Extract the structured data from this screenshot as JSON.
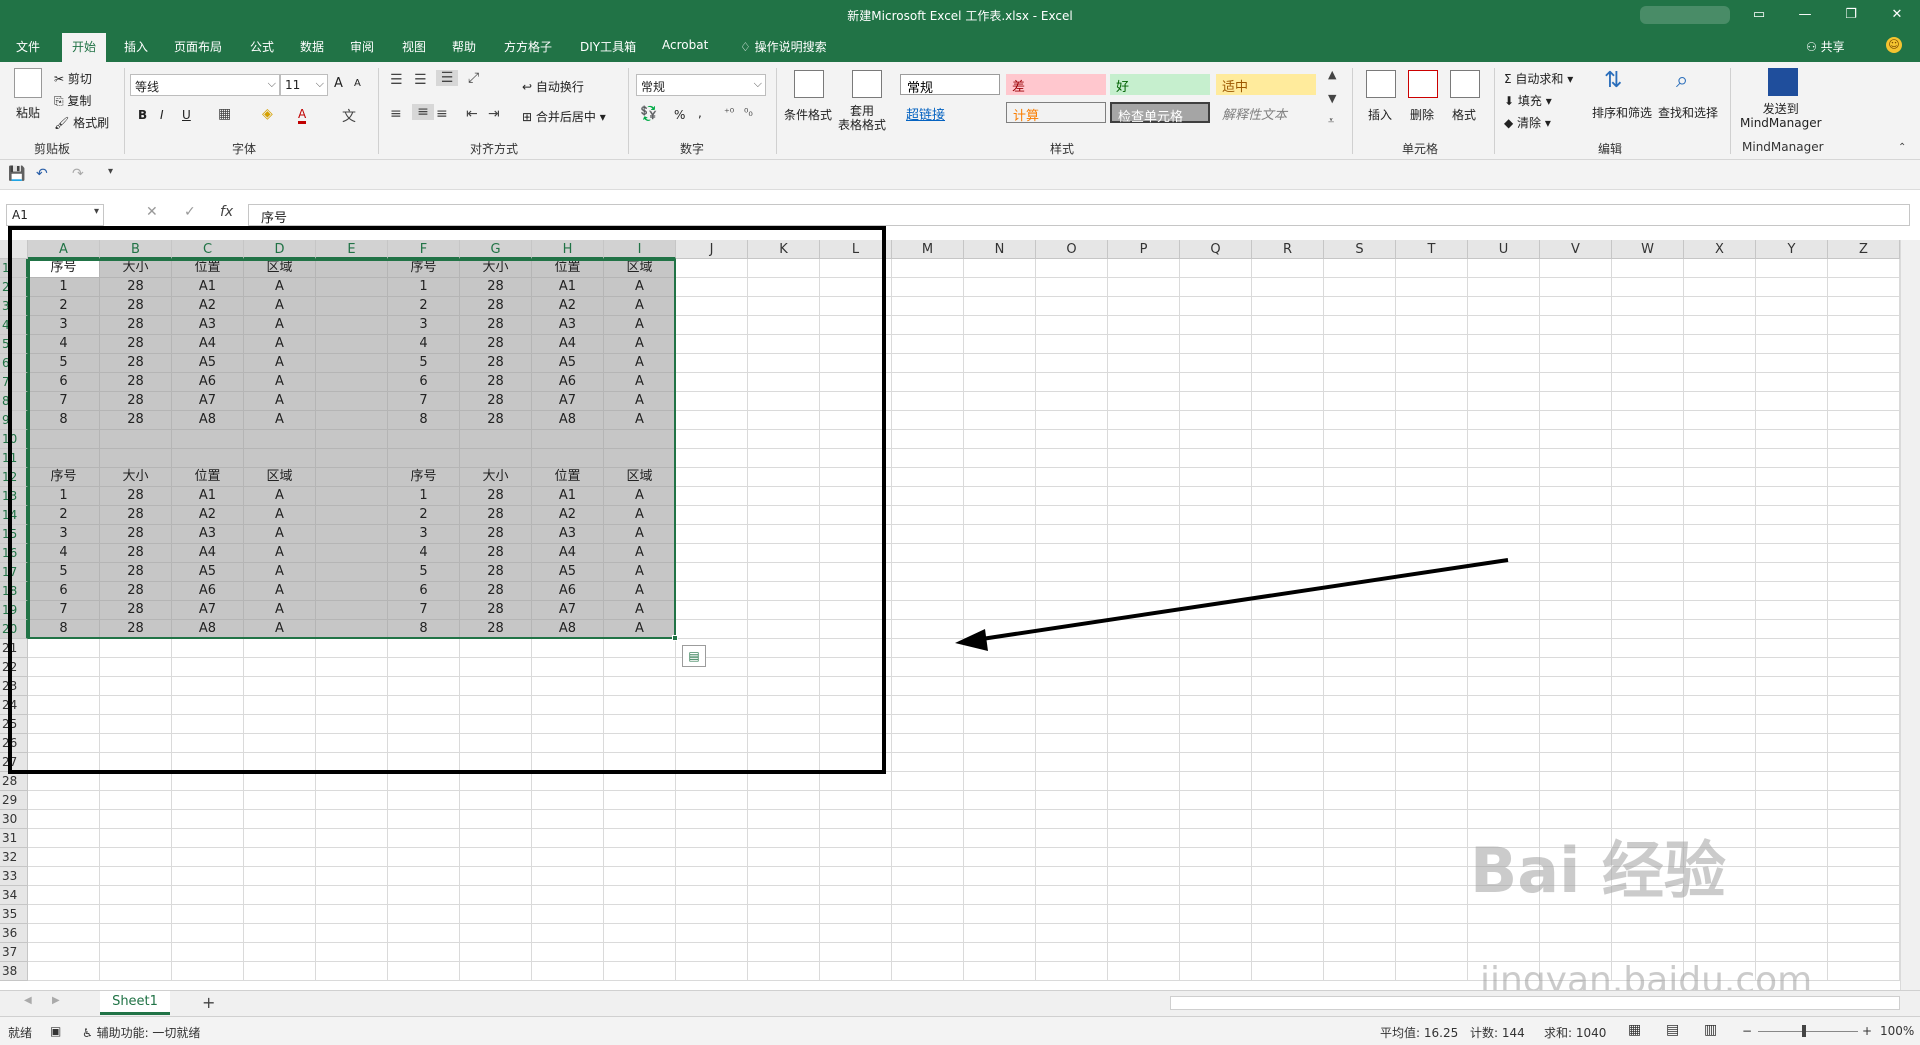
{
  "window": {
    "title": "新建Microsoft Excel 工作表.xlsx  -  Excel",
    "minimize": "—",
    "restore": "❐",
    "close": "✕",
    "ribbon_display": "▭"
  },
  "tabs": [
    "文件",
    "开始",
    "插入",
    "页面布局",
    "公式",
    "数据",
    "审阅",
    "视图",
    "帮助",
    "方方格子",
    "DIY工具箱",
    "Acrobat"
  ],
  "active_tab": "开始",
  "tell_me": "操作说明搜索",
  "share": "共享",
  "ribbon": {
    "clipboard": {
      "paste": "粘贴",
      "cut": "剪切",
      "copy": "复制",
      "format_painter": "格式刷",
      "label": "剪贴板"
    },
    "font": {
      "name": "等线",
      "size": "11",
      "bold": "B",
      "italic": "I",
      "underline": "U",
      "font_color": "A",
      "label": "字体",
      "grow": "A",
      "shrink": "A"
    },
    "alignment": {
      "wrap": "自动换行",
      "merge": "合并后居中",
      "label": "对齐方式"
    },
    "number": {
      "format": "常规",
      "percent": "%",
      "comma": ",",
      "label": "数字"
    },
    "styles": {
      "conditional": "条件格式",
      "table": "套用\n表格格式",
      "cells": [
        {
          "text": "常规",
          "bg": "#ffffff",
          "fg": "#000000"
        },
        {
          "text": "差",
          "bg": "#ffc7ce",
          "fg": "#9c0006"
        },
        {
          "text": "好",
          "bg": "#c6efce",
          "fg": "#006100"
        },
        {
          "text": "适中",
          "bg": "#ffeb9c",
          "fg": "#9c5700"
        },
        {
          "text": "超链接",
          "bg": "#f3f3f3",
          "fg": "#0563c1"
        },
        {
          "text": "计算",
          "bg": "#f2f2f2",
          "fg": "#fa7d00"
        },
        {
          "text": "检查单元格",
          "bg": "#a5a5a5",
          "fg": "#ffffff"
        },
        {
          "text": "解释性文本",
          "bg": "#f3f3f3",
          "fg": "#7f7f7f"
        }
      ],
      "label": "样式"
    },
    "cells_group": {
      "insert": "插入",
      "delete": "删除",
      "format": "格式",
      "label": "单元格"
    },
    "editing": {
      "autosum": "自动求和",
      "fill": "填充",
      "clear": "清除",
      "sort": "排序和筛选",
      "find": "查找和选择",
      "label": "编辑"
    },
    "mindmanager": {
      "send": "发送到\nMindManager",
      "label": "MindManager"
    }
  },
  "name_box": "A1",
  "formula": "序号",
  "fx": "fx",
  "columns": [
    "A",
    "B",
    "C",
    "D",
    "E",
    "F",
    "G",
    "H",
    "I",
    "J",
    "K",
    "L",
    "M",
    "N",
    "O",
    "P",
    "Q",
    "R",
    "S",
    "T",
    "U",
    "V",
    "W",
    "X",
    "Y",
    "Z"
  ],
  "rows": [
    "1",
    "2",
    "3",
    "4",
    "5",
    "6",
    "7",
    "8",
    "9",
    "10",
    "11",
    "12",
    "13",
    "14",
    "15",
    "16",
    "17",
    "18",
    "19",
    "20",
    "21",
    "22",
    "23",
    "24",
    "25",
    "26",
    "27",
    "28",
    "29",
    "30",
    "31",
    "32",
    "33",
    "34",
    "35",
    "36",
    "37",
    "38"
  ],
  "grid": {
    "header": [
      "序号",
      "大小",
      "位置",
      "区域"
    ],
    "rows": [
      [
        "1",
        "28",
        "A1",
        "A"
      ],
      [
        "2",
        "28",
        "A2",
        "A"
      ],
      [
        "3",
        "28",
        "A3",
        "A"
      ],
      [
        "4",
        "28",
        "A4",
        "A"
      ],
      [
        "5",
        "28",
        "A5",
        "A"
      ],
      [
        "6",
        "28",
        "A6",
        "A"
      ],
      [
        "7",
        "28",
        "A7",
        "A"
      ],
      [
        "8",
        "28",
        "A8",
        "A"
      ]
    ]
  },
  "sheet": {
    "name": "Sheet1",
    "add": "+"
  },
  "status": {
    "ready": "就绪",
    "accessibility": "辅助功能: 一切就绪",
    "average": "平均值: 16.25",
    "count": "计数: 144",
    "sum": "求和: 1040",
    "zoom": "100%",
    "minus": "−",
    "plus": "+"
  },
  "watermark": {
    "main": "Bai 经验",
    "sub": "jingyan.baidu.com"
  },
  "colors": {
    "excel_green": "#217346",
    "selection": "#c6c6c6"
  }
}
